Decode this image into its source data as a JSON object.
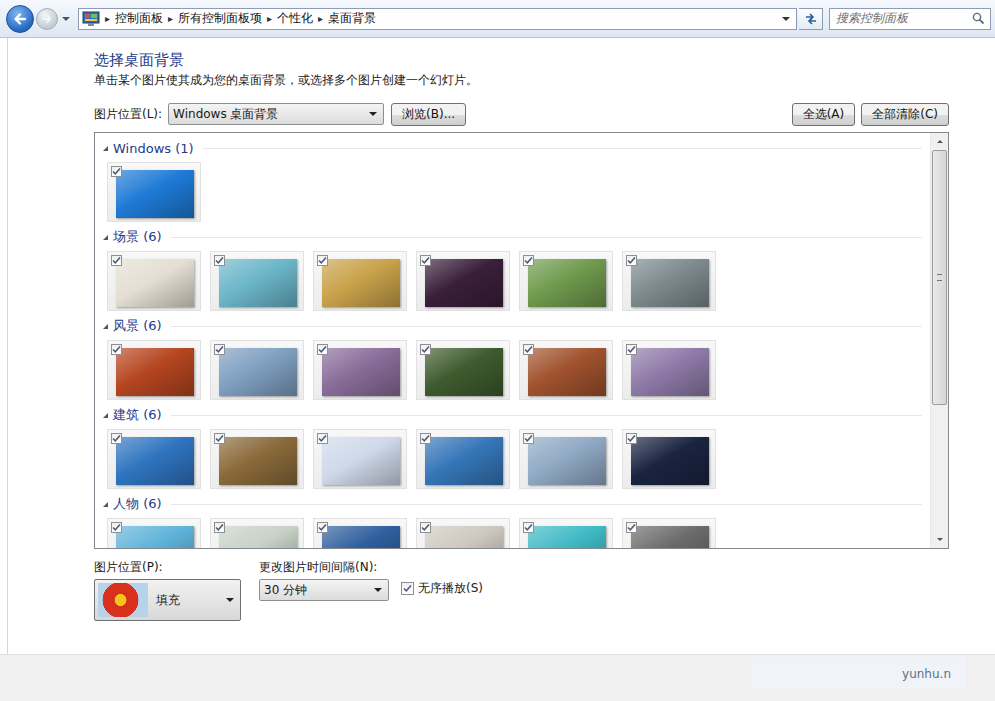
{
  "window": {
    "breadcrumb": [
      "控制面板",
      "所有控制面板项",
      "个性化",
      "桌面背景"
    ],
    "separator": "▸",
    "search_placeholder": "搜索控制面板"
  },
  "heading": "选择桌面背景",
  "description": "单击某个图片使其成为您的桌面背景，或选择多个图片创建一个幻灯片。",
  "location": {
    "label": "图片位置(L):",
    "value": "Windows 桌面背景",
    "browse": "浏览(B)..."
  },
  "buttons": [
    "全选(A)",
    "全部清除(C)"
  ],
  "groups": [
    {
      "title": "Windows (1)",
      "expanded": true,
      "pictures": [
        {
          "checked": true,
          "color": "#1e7ad6"
        }
      ]
    },
    {
      "title": "场景 (6)",
      "expanded": true,
      "pictures": [
        {
          "checked": true,
          "color": "#e4dfd2"
        },
        {
          "checked": true,
          "color": "#6bb6c9"
        },
        {
          "checked": true,
          "color": "#c9a24a"
        },
        {
          "checked": true,
          "color": "#3a1f3a"
        },
        {
          "checked": true,
          "color": "#6f9a4d"
        },
        {
          "checked": true,
          "color": "#7c8a8e"
        }
      ]
    },
    {
      "title": "风景 (6)",
      "expanded": true,
      "pictures": [
        {
          "checked": true,
          "color": "#b5451f"
        },
        {
          "checked": true,
          "color": "#7f9fc1"
        },
        {
          "checked": true,
          "color": "#8a6d9a"
        },
        {
          "checked": true,
          "color": "#3f5b2e"
        },
        {
          "checked": true,
          "color": "#a0522d"
        },
        {
          "checked": true,
          "color": "#8e7aa8"
        }
      ]
    },
    {
      "title": "建筑 (6)",
      "expanded": true,
      "pictures": [
        {
          "checked": true,
          "color": "#2f74c0"
        },
        {
          "checked": true,
          "color": "#8a6a3a"
        },
        {
          "checked": true,
          "color": "#cfd9ea"
        },
        {
          "checked": true,
          "color": "#3576b8"
        },
        {
          "checked": true,
          "color": "#90a9c4"
        },
        {
          "checked": true,
          "color": "#1a2440"
        }
      ]
    },
    {
      "title": "人物 (6)",
      "expanded": true,
      "pictures": [
        {
          "checked": true,
          "color": "#5fb3d9"
        },
        {
          "checked": true,
          "color": "#c8d2c6"
        },
        {
          "checked": true,
          "color": "#2f5f9e"
        },
        {
          "checked": true,
          "color": "#cfc8c0"
        },
        {
          "checked": true,
          "color": "#3fb9c4"
        },
        {
          "checked": true,
          "color": "#6b6b6b"
        }
      ]
    }
  ],
  "position": {
    "label": "图片位置(P):",
    "value": "填充"
  },
  "interval": {
    "label": "更改图片时间间隔(N):",
    "value": "30 分钟"
  },
  "shuffle": {
    "label": "无序播放(S)",
    "checked": true
  },
  "watermark": "yunhu.n"
}
